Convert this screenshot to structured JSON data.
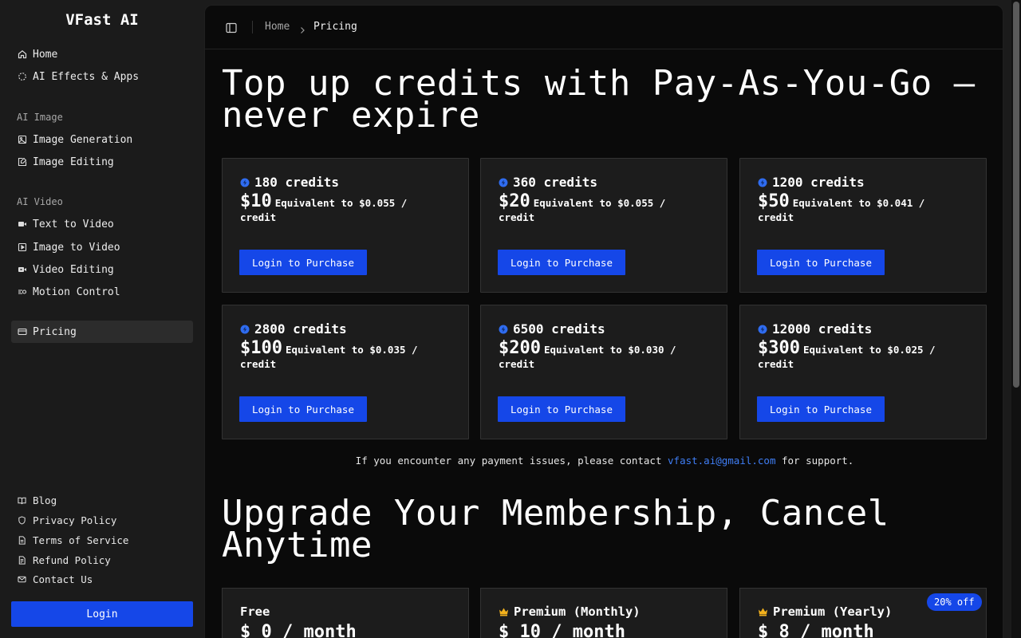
{
  "brand": "VFast AI",
  "nav": {
    "home": "Home",
    "effects": "AI Effects & Apps",
    "group_image": "AI Image",
    "image_generation": "Image Generation",
    "image_editing": "Image Editing",
    "group_video": "AI Video",
    "text_to_video": "Text to Video",
    "image_to_video": "Image to Video",
    "video_editing": "Video Editing",
    "motion_control": "Motion Control",
    "pricing": "Pricing"
  },
  "footer": {
    "blog": "Blog",
    "privacy": "Privacy Policy",
    "terms": "Terms of Service",
    "refund": "Refund Policy",
    "contact": "Contact Us",
    "login": "Login"
  },
  "breadcrumb": {
    "home": "Home",
    "current": "Pricing"
  },
  "topup": {
    "title_line1": "Top up credits with Pay-As-You-Go —",
    "title_line2": "never expire",
    "button_label": "Login to Purchase",
    "packages": [
      {
        "credits": "180 credits",
        "price": "$10",
        "equiv": "Equivalent to $0.055 / credit"
      },
      {
        "credits": "360 credits",
        "price": "$20",
        "equiv": "Equivalent to $0.055 / credit"
      },
      {
        "credits": "1200 credits",
        "price": "$50",
        "equiv": "Equivalent to $0.041 / credit"
      },
      {
        "credits": "2800 credits",
        "price": "$100",
        "equiv": "Equivalent to $0.035 / credit"
      },
      {
        "credits": "6500 credits",
        "price": "$200",
        "equiv": "Equivalent to $0.030 / credit"
      },
      {
        "credits": "12000 credits",
        "price": "$300",
        "equiv": "Equivalent to $0.025 / credit"
      }
    ]
  },
  "support": {
    "prefix": "If you encounter any payment issues, please contact ",
    "email": "vfast.ai@gmail.com",
    "suffix": " for support."
  },
  "membership": {
    "title_line1": "Upgrade Your Membership, Cancel",
    "title_line2": "Anytime",
    "plans": [
      {
        "name": "Free",
        "price": "$ 0 / month"
      },
      {
        "name": "Premium (Monthly)",
        "price": "$ 10 / month"
      },
      {
        "name": "Premium (Yearly)",
        "price": "$ 8 / month"
      }
    ],
    "yearly_badge": "20% off"
  },
  "colors": {
    "accent": "#1547e8",
    "link": "#3f7ef5",
    "crown": "#f2b11c"
  }
}
